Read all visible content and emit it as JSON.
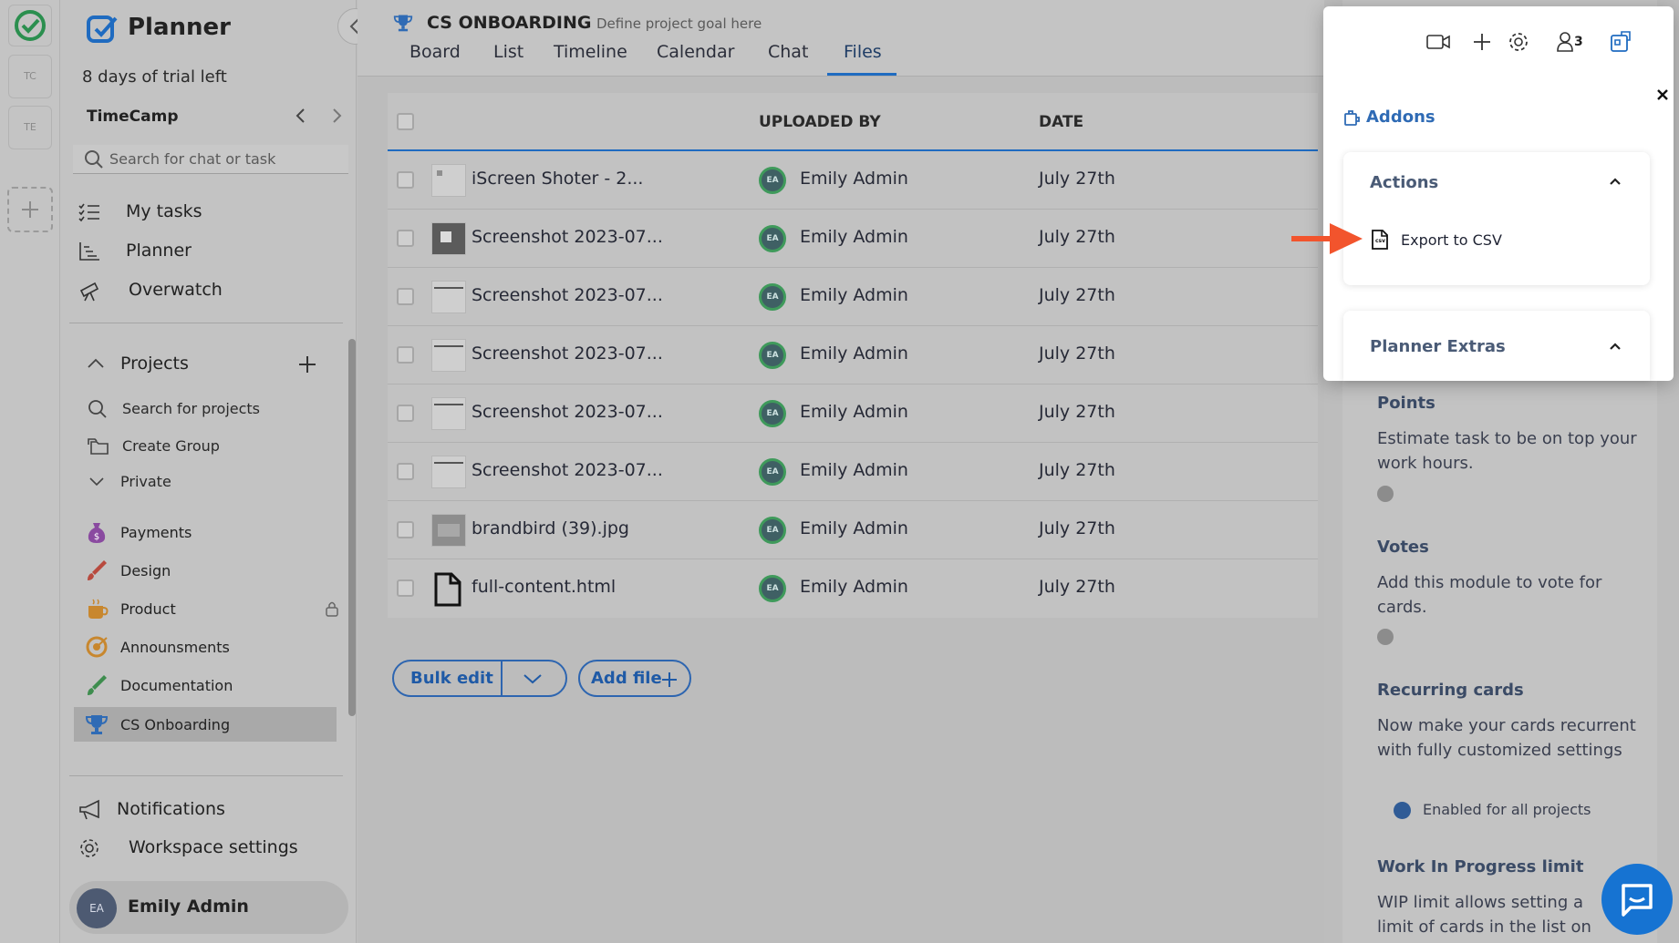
{
  "rail": {
    "ws1": "TC",
    "ws2": "TE"
  },
  "sidebar": {
    "brand": "Planner",
    "trial": "8 days of trial left",
    "workspace": "TimeCamp",
    "search_placeholder": "Search for chat or task",
    "nav": [
      "My tasks",
      "Planner",
      "Overwatch"
    ],
    "projects_label": "Projects",
    "search_projects": "Search for projects",
    "create_group": "Create Group",
    "private": "Private",
    "projects": [
      "Payments",
      "Design",
      "Product",
      "Announsments",
      "Documentation",
      "CS Onboarding"
    ],
    "notifications": "Notifications",
    "workspace_settings": "Workspace settings",
    "user": {
      "initials": "EA",
      "name": "Emily Admin"
    }
  },
  "header": {
    "project": "CS ONBOARDING",
    "goal": "Define project goal here",
    "tabs": [
      "Board",
      "List",
      "Timeline",
      "Calendar",
      "Chat",
      "Files"
    ],
    "active_tab": "Files"
  },
  "table": {
    "col_uploaded": "UPLOADED BY",
    "col_date": "DATE",
    "rows": [
      {
        "name": "iScreen Shoter - 2...",
        "initials": "EA",
        "uploader": "Emily Admin",
        "date": "July 27th"
      },
      {
        "name": "Screenshot 2023-07...",
        "initials": "EA",
        "uploader": "Emily Admin",
        "date": "July 27th"
      },
      {
        "name": "Screenshot 2023-07...",
        "initials": "EA",
        "uploader": "Emily Admin",
        "date": "July 27th"
      },
      {
        "name": "Screenshot 2023-07...",
        "initials": "EA",
        "uploader": "Emily Admin",
        "date": "July 27th"
      },
      {
        "name": "Screenshot 2023-07...",
        "initials": "EA",
        "uploader": "Emily Admin",
        "date": "July 27th"
      },
      {
        "name": "Screenshot 2023-07...",
        "initials": "EA",
        "uploader": "Emily Admin",
        "date": "July 27th"
      },
      {
        "name": "brandbird (39).jpg",
        "initials": "EA",
        "uploader": "Emily Admin",
        "date": "July 27th"
      },
      {
        "name": "full-content.html",
        "initials": "EA",
        "uploader": "Emily Admin",
        "date": "July 27th"
      }
    ]
  },
  "actions": {
    "bulk_edit": "Bulk edit",
    "add_file": "Add file"
  },
  "popup": {
    "members_count": "3",
    "addons": "Addons",
    "actions_title": "Actions",
    "export_csv": "Export to CSV",
    "csv_icon_text": "csv",
    "extras_title": "Planner Extras"
  },
  "rpanel": {
    "points_title": "Points",
    "points_desc": "Estimate task to be on top your work hours.",
    "votes_title": "Votes",
    "votes_desc": "Add this module to vote for cards.",
    "recurring_title": "Recurring cards",
    "recurring_desc": "Now make your cards recurrent with fully customized settings",
    "recurring_option": "Enabled for all projects",
    "wip_title": "Work In Progress limit",
    "wip_desc": "WIP limit allows setting a limit of cards in the list on"
  },
  "colors": {
    "accent": "#1f6bc0",
    "annotation_arrow": "#f2542d",
    "brand_green": "#2fae5c"
  }
}
